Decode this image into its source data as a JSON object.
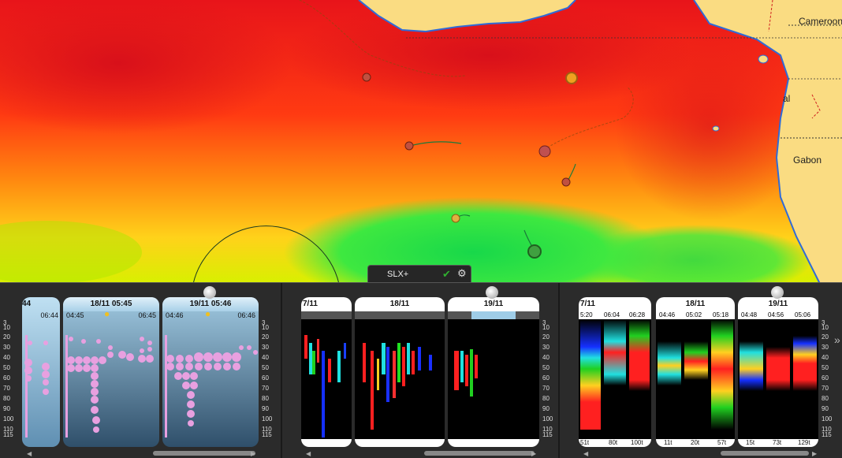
{
  "map": {
    "labels": {
      "cameroon": "Cameroon",
      "gabon": "Gabon",
      "eq_guinea_fragment": "al"
    }
  },
  "panel": {
    "tab": {
      "label": "SLX+",
      "check_icon": "check-icon",
      "settings_icon": "gear-icon"
    },
    "section1": {
      "cards": [
        {
          "date": "",
          "partial_date": "44",
          "time_left": "",
          "time_right": "06:44"
        },
        {
          "date": "18/11 05:45",
          "time_left": "04:45",
          "time_right": "06:45",
          "icon": "sun-icon"
        },
        {
          "date": "19/11 05:46",
          "time_left": "04:46",
          "time_right": "06:46",
          "icon": "sun-icon"
        }
      ],
      "depth_left": [
        "3",
        "10",
        "20",
        "30",
        "40",
        "50",
        "60",
        "70",
        "80",
        "90",
        "100",
        "110",
        "115"
      ],
      "depth_right": [
        "3",
        "10",
        "20",
        "30",
        "40",
        "50",
        "60",
        "70",
        "80",
        "90",
        "100",
        "110",
        "115"
      ]
    },
    "section2": {
      "cards": [
        {
          "date": "7/11"
        },
        {
          "date": "18/11"
        },
        {
          "date": "19/11"
        }
      ],
      "depth_right": [
        "3",
        "10",
        "20",
        "30",
        "40",
        "50",
        "60",
        "70",
        "80",
        "90",
        "100",
        "110",
        "115"
      ]
    },
    "section3": {
      "cards": [
        {
          "date": "7/11",
          "times": [
            "5:20",
            "06:04",
            "06:28"
          ],
          "foot": [
            "51t",
            "80t",
            "100t"
          ]
        },
        {
          "date": "18/11",
          "times": [
            "04:46",
            "05:02",
            "05:18"
          ],
          "foot": [
            "11t",
            "20t",
            "57t"
          ]
        },
        {
          "date": "19/11",
          "times": [
            "04:48",
            "04:56",
            "05:06"
          ],
          "foot": [
            "15t",
            "73t",
            "129t"
          ]
        }
      ],
      "depth_right": [
        "3",
        "10",
        "20",
        "30",
        "40",
        "50",
        "60",
        "70",
        "80",
        "90",
        "100",
        "110",
        "115"
      ]
    },
    "colors": {
      "sonar_pink": "#e8a0e0",
      "card_blue": "#9fcde8",
      "panel_bg": "#2b2b2b"
    }
  }
}
